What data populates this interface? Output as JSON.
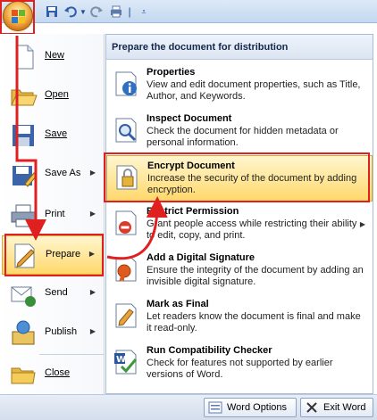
{
  "quick_access": {
    "save_icon": "save-icon",
    "undo_icon": "undo-icon",
    "redo_icon": "redo-icon",
    "print_icon": "print-icon",
    "customize_icon": "customize-icon"
  },
  "left_menu": {
    "items": [
      {
        "label": "New",
        "icon": "new-document-icon"
      },
      {
        "label": "Open",
        "icon": "open-folder-icon"
      },
      {
        "label": "Save",
        "icon": "save-icon"
      },
      {
        "label": "Save As",
        "icon": "save-as-icon"
      },
      {
        "label": "Print",
        "icon": "printer-icon"
      },
      {
        "label": "Prepare",
        "icon": "prepare-icon"
      },
      {
        "label": "Send",
        "icon": "send-icon"
      },
      {
        "label": "Publish",
        "icon": "publish-icon"
      },
      {
        "label": "Close",
        "icon": "close-folder-icon"
      }
    ]
  },
  "right_pane": {
    "header": "Prepare the document for distribution",
    "options": [
      {
        "title": "Properties",
        "desc": "View and edit document properties, such as Title, Author, and Keywords.",
        "icon": "properties-icon"
      },
      {
        "title": "Inspect Document",
        "desc": "Check the document for hidden metadata or personal information.",
        "icon": "inspect-icon"
      },
      {
        "title": "Encrypt Document",
        "desc": "Increase the security of the document by adding encryption.",
        "icon": "encrypt-icon"
      },
      {
        "title": "Restrict Permission",
        "desc": "Grant people access while restricting their ability to edit, copy, and print.",
        "icon": "restrict-icon"
      },
      {
        "title": "Add a Digital Signature",
        "desc": "Ensure the integrity of the document by adding an invisible digital signature.",
        "icon": "signature-icon"
      },
      {
        "title": "Mark as Final",
        "desc": "Let readers know the document is final and make it read-only.",
        "icon": "mark-final-icon"
      },
      {
        "title": "Run Compatibility Checker",
        "desc": "Check for features not supported by earlier versions of Word.",
        "icon": "compatibility-icon"
      }
    ]
  },
  "bottom": {
    "word_options": "Word Options",
    "exit_word": "Exit Word"
  },
  "colors": {
    "highlight_border": "#d8a83a",
    "annotation_red": "#e02020"
  }
}
